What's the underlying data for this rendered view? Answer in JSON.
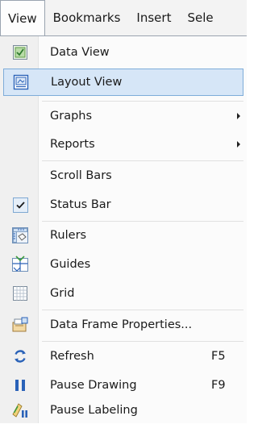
{
  "menubar": {
    "items": [
      {
        "label": "View"
      },
      {
        "label": "Bookmarks"
      },
      {
        "label": "Insert"
      },
      {
        "label": "Sele"
      }
    ]
  },
  "view_menu": {
    "items": [
      {
        "label": "Data View",
        "icon": "data-view-icon"
      },
      {
        "label": "Layout View",
        "icon": "layout-view-icon",
        "highlighted": true
      },
      {
        "label": "Graphs",
        "submenu": true
      },
      {
        "label": "Reports",
        "submenu": true
      },
      {
        "label": "Scroll Bars"
      },
      {
        "label": "Status Bar",
        "checked": true,
        "icon": "checkmark-icon"
      },
      {
        "label": "Rulers",
        "icon": "rulers-icon"
      },
      {
        "label": "Guides",
        "icon": "guides-icon"
      },
      {
        "label": "Grid",
        "icon": "grid-icon"
      },
      {
        "label": "Data Frame Properties...",
        "icon": "data-frame-properties-icon"
      },
      {
        "label": "Refresh",
        "shortcut": "F5",
        "icon": "refresh-icon"
      },
      {
        "label": "Pause Drawing",
        "shortcut": "F9",
        "icon": "pause-icon"
      },
      {
        "label": "Pause Labeling",
        "icon": "pause-labeling-icon"
      }
    ]
  },
  "colors": {
    "highlight_bg": "#d6e6f7",
    "highlight_border": "#7eacd9",
    "icon_blue": "#2a62b8",
    "icon_green": "#3c9b3c"
  }
}
